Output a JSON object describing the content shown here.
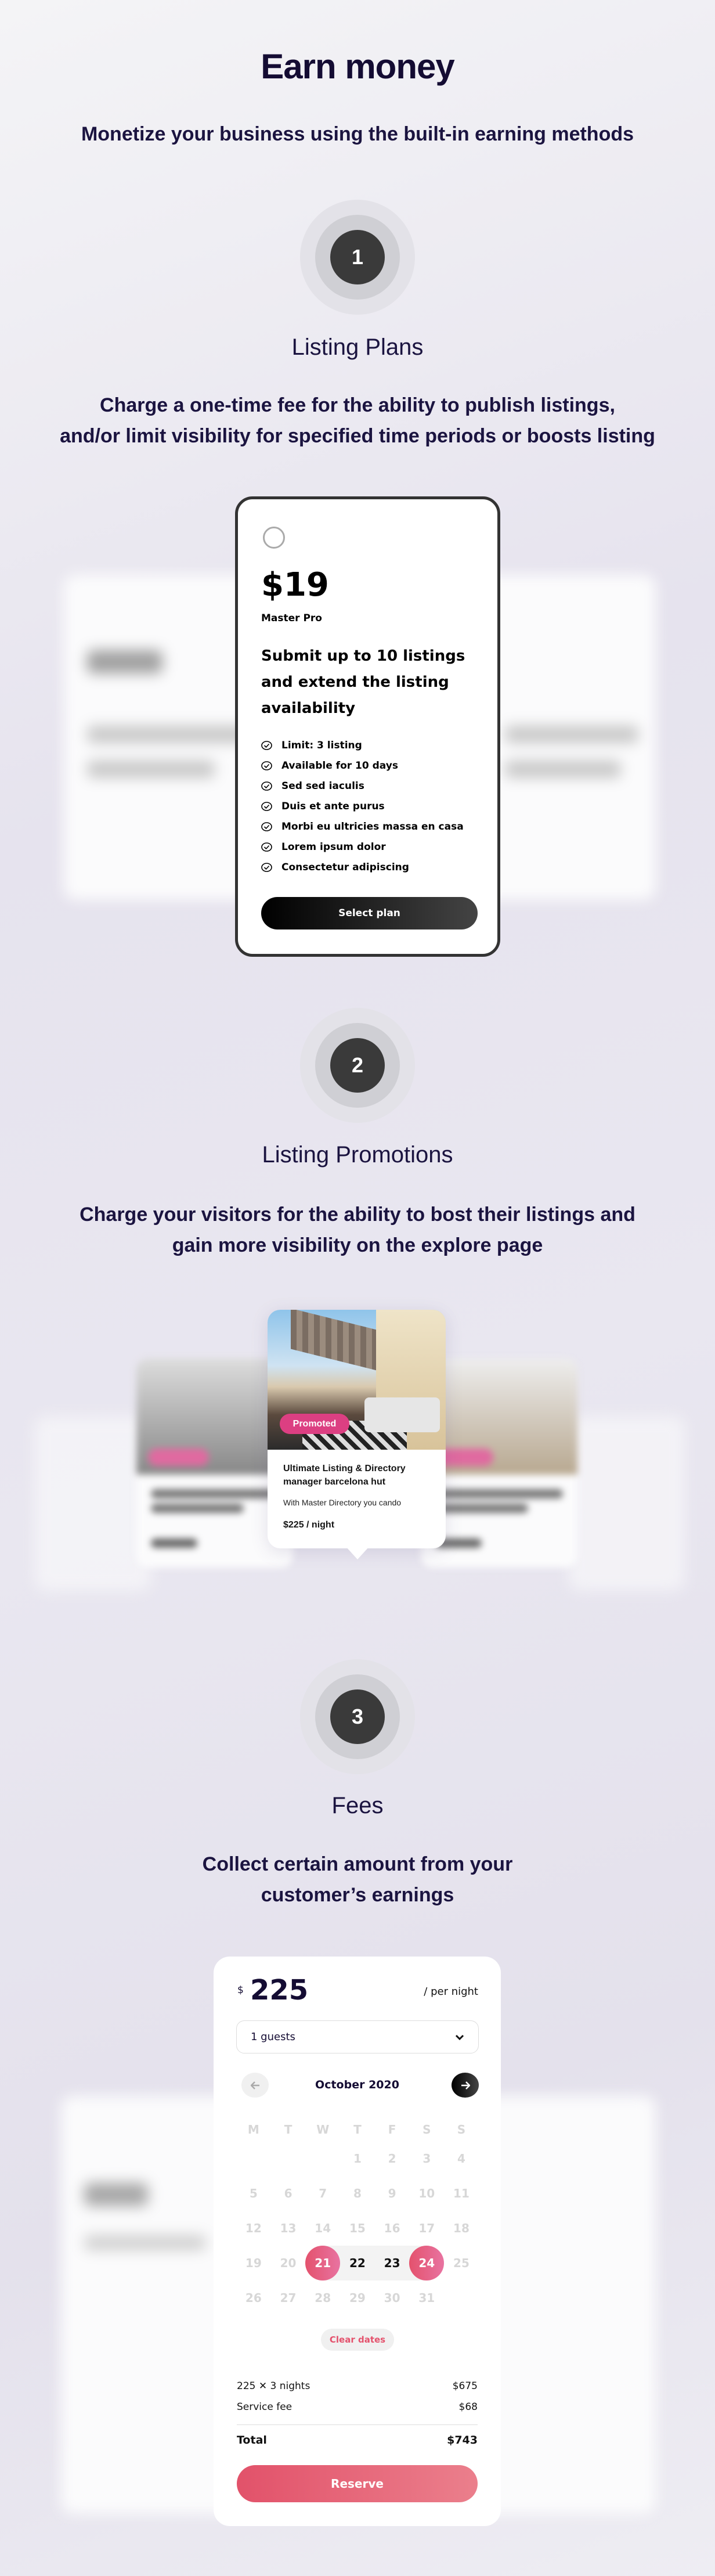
{
  "header": {
    "title": "Earn money",
    "subtitle": "Monetize your business using the built-in earning methods"
  },
  "colors": {
    "title": "#140c33",
    "accent_pink": "#dc3f82",
    "reserve": "#e2526a",
    "dark": "#333333"
  },
  "sections": [
    {
      "number": "1",
      "title": "Listing Plans",
      "desc_lines": [
        "Charge a one-time fee for the ability to publish listings,",
        "and/or limit visibility for specified time periods or boosts listing"
      ]
    },
    {
      "number": "2",
      "title": "Listing Promotions",
      "desc_lines": [
        "Charge your visitors for the ability to bost their listings and",
        "gain more visibility on the explore page"
      ]
    },
    {
      "number": "3",
      "title": "Fees",
      "desc_lines": [
        "Collect certain amount from your",
        "customer’s earnings"
      ]
    }
  ],
  "plan": {
    "price": "$19",
    "name": "Master Pro",
    "heading": "Submit up to 10 listings and extend the listing availability",
    "features": [
      "Limit: 3 listing",
      "Available for 10 days",
      "Sed sed iaculis",
      "Duis et ante purus",
      "Morbi eu ultricies massa en casa",
      "Lorem ipsum dolor",
      "Consectetur adipiscing"
    ],
    "button": "Select plan",
    "feature_icon": "check-circle-icon"
  },
  "promo": {
    "badge": "Promoted",
    "title": "Ultimate Listing & Directory manager barcelona hut",
    "desc": "With Master Directory you cando",
    "price": "$225 / night"
  },
  "booking": {
    "currency": "$",
    "amount": "225",
    "per": "/ per night",
    "guests": "1 guests",
    "month": "October 2020",
    "weekdays": [
      "M",
      "T",
      "W",
      "T",
      "F",
      "S",
      "S"
    ],
    "weeks": [
      [
        "",
        "",
        "",
        "1",
        "2",
        "3",
        "4"
      ],
      [
        "5",
        "6",
        "7",
        "8",
        "9",
        "10",
        "11"
      ],
      [
        "12",
        "13",
        "14",
        "15",
        "16",
        "17",
        "18"
      ],
      [
        "19",
        "20",
        "21",
        "22",
        "23",
        "24",
        "25"
      ],
      [
        "26",
        "27",
        "28",
        "29",
        "30",
        "31",
        ""
      ]
    ],
    "selected_start": "21",
    "selected_end": "24",
    "clear": "Clear dates",
    "lines": [
      {
        "label": "225 ✕ 3 nights",
        "value": "$675"
      },
      {
        "label": "Service fee",
        "value": "$68"
      }
    ],
    "total_label": "Total",
    "total_value": "$743",
    "reserve": "Reserve"
  }
}
